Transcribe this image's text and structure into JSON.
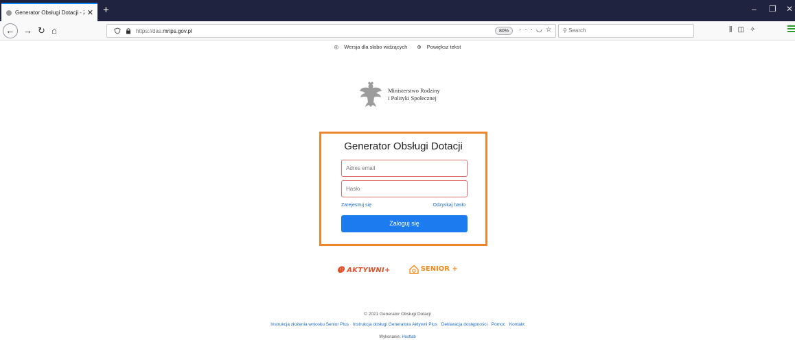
{
  "browser": {
    "tab_title": "Generator Obsługi Dotacji - Za",
    "url_host": "https://das.",
    "url_domain": "mrips.gov.pl",
    "zoom": "80%",
    "search_placeholder": "Search",
    "new_tab": "+",
    "tab_close": "✕"
  },
  "accessibility": {
    "low_vision": "Wersja dla słabo widzących",
    "enlarge_text": "Powiększ tekst"
  },
  "ministry": {
    "line1": "Ministerstwo Rodziny",
    "line2": "i Polityki Społecznej"
  },
  "login": {
    "title": "Generator Obsługi Dotacji",
    "email_placeholder": "Adres email",
    "password_placeholder": "Hasło",
    "register": "Zarejestruj się",
    "recover": "Odzyskaj hasło",
    "submit": "Zaloguj się"
  },
  "partners": {
    "aktywni": "AKTYWNI+",
    "senior": "SENIOR +"
  },
  "footer": {
    "copyright": "© 2021 Generator Obsługi Dotacji",
    "links": [
      "Instrukcja złożenia wniosku Senior Plus",
      "Instrukcja obsługi Generatora Aktywni Plus",
      "Deklaracja dostępności",
      "Pomoc",
      "Kontakt"
    ],
    "credits_label": "Wykonanie:",
    "credits_company": "Hostlab"
  },
  "colors": {
    "accent_border": "#f0862c",
    "primary_button": "#1d7bf0",
    "link": "#1b6ac9",
    "field_error_border": "#e06a6a"
  }
}
